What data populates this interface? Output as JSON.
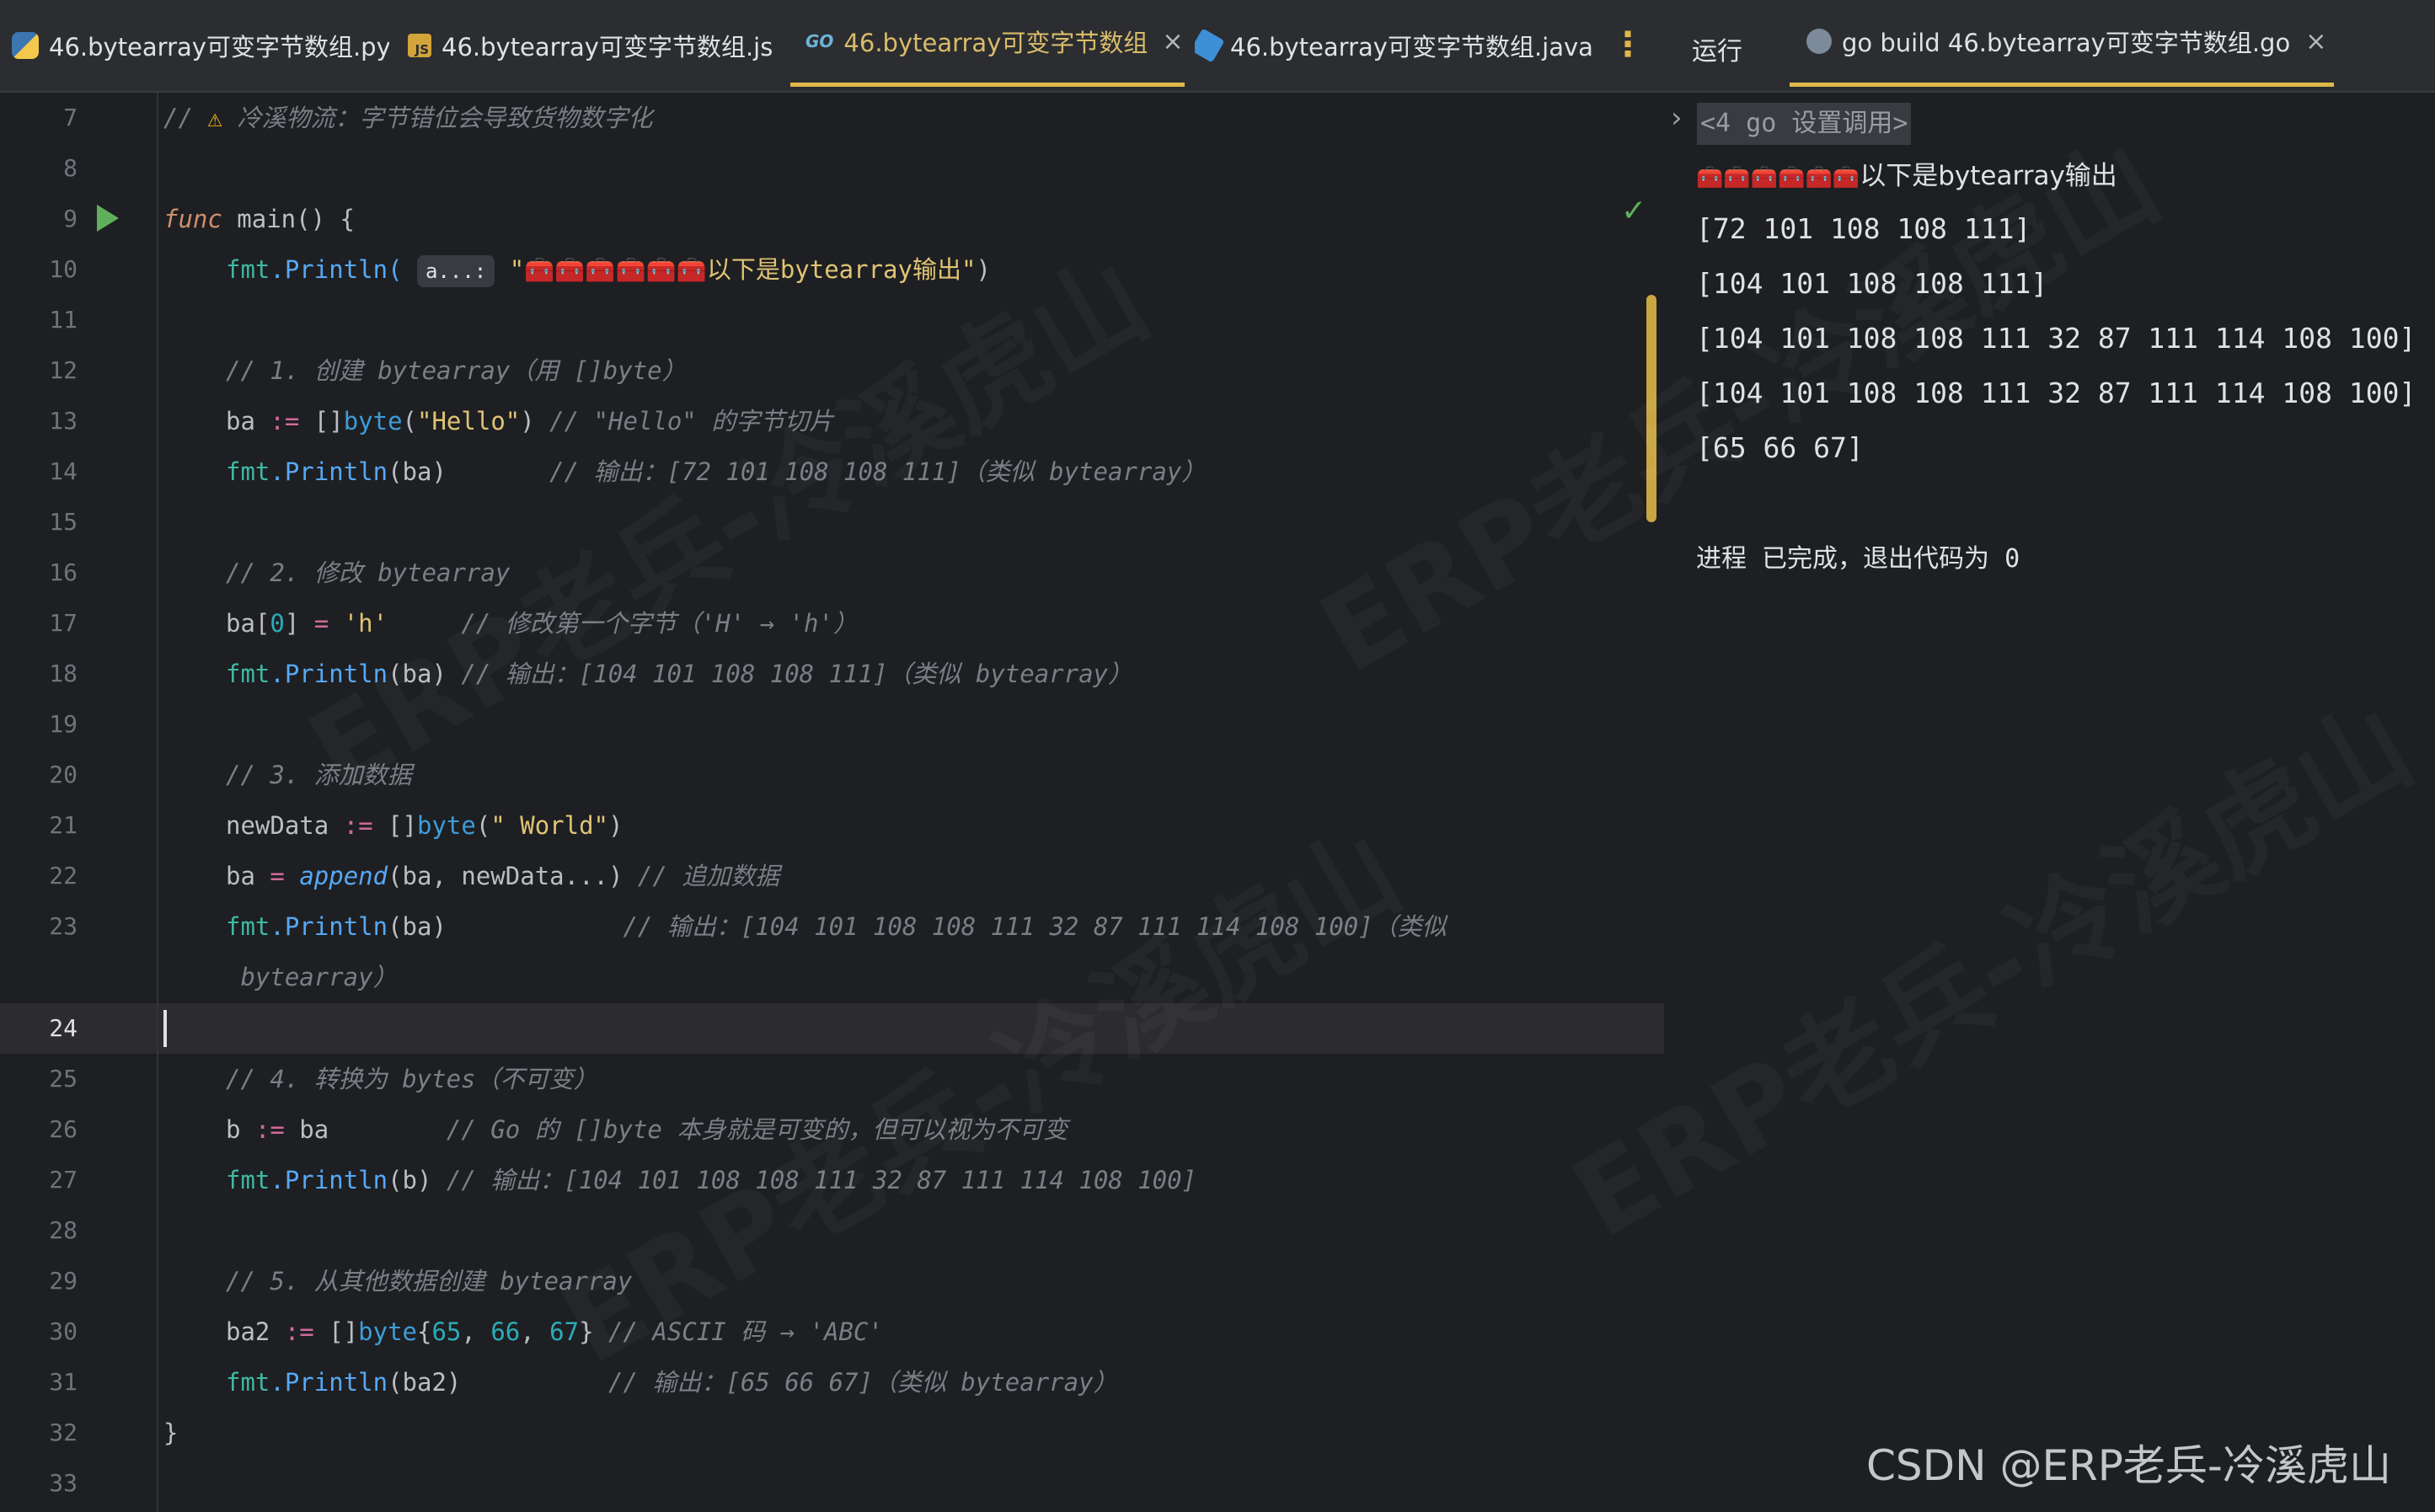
{
  "tabs": [
    {
      "label": "46.bytearray可变字节数组.py",
      "icon": "python-file-icon"
    },
    {
      "label": "46.bytearray可变字节数组.js",
      "icon": "javascript-file-icon"
    },
    {
      "label": "46.bytearray可变字节数组.go",
      "icon": "go-file-icon",
      "active": true
    },
    {
      "label": "46.bytearray可变字节数组.java",
      "icon": "java-file-icon"
    }
  ],
  "go_icon_text": "GO",
  "js_icon_text": "JS",
  "close_glyph": "×",
  "more_glyph": "⋮",
  "run_panel": {
    "title": "运行",
    "config_tab": "go build 46.bytearray可变字节数组.go",
    "command": "<4 go 设置调用>",
    "output_header": "以下是bytearray输出",
    "output_lines": [
      "[72 101 108 108 111]",
      "[104 101 108 108 111]",
      "[104 101 108 108 111 32 87 111 114 108 100]",
      "[104 101 108 108 111 32 87 111 114 108 100]",
      "[65 66 67]"
    ],
    "process_done": "进程 已完成，退出代码为 0"
  },
  "editor": {
    "line_numbers": [
      "7",
      "8",
      "9",
      "10",
      "11",
      "12",
      "13",
      "14",
      "15",
      "16",
      "17",
      "18",
      "19",
      "20",
      "21",
      "22",
      "23",
      "24",
      "25",
      "26",
      "27",
      "28",
      "29",
      "30",
      "31",
      "32",
      "33"
    ],
    "current_line": "24",
    "hint_label": "a...:",
    "lines": {
      "l7_comment": "// ",
      "l7_warn": "⚠",
      "l7_text": " 冷溪物流：字节错位会导致货物数字化",
      "l9_kw": "func",
      "l9_rest": " main() {",
      "l10_pkg": "fmt",
      "l10_fn": ".Println(",
      "l10_str_open": "\"",
      "l10_toolboxes": "🧰🧰🧰🧰🧰🧰",
      "l10_str": "以下是bytearray输出\"",
      "l10_close": ")",
      "l12": "// 1. 创建 bytearray（用 []byte）",
      "l13_a": "ba ",
      "l13_op": ":=",
      "l13_b": " []",
      "l13_typ": "byte",
      "l13_c": "(",
      "l13_str": "\"Hello\"",
      "l13_d": ") ",
      "l13_cmt": "// \"Hello\" 的字节切片",
      "l14_pkg": "fmt",
      "l14_fn": ".Println",
      "l14_b": "(ba)       ",
      "l14_cmt": "// 输出：[72 101 108 108 111]（类似 bytearray）",
      "l16": "// 2. 修改 bytearray",
      "l17_a": "ba[",
      "l17_num": "0",
      "l17_b": "] ",
      "l17_op": "=",
      "l17_c": " ",
      "l17_str": "'h'",
      "l17_d": "     ",
      "l17_cmt": "// 修改第一个字节（'H' → 'h'）",
      "l18_pkg": "fmt",
      "l18_fn": ".Println",
      "l18_b": "(ba) ",
      "l18_cmt": "// 输出：[104 101 108 108 111]（类似 bytearray）",
      "l20": "// 3. 添加数据",
      "l21_a": "newData ",
      "l21_op": ":=",
      "l21_b": " []",
      "l21_typ": "byte",
      "l21_c": "(",
      "l21_str": "\" World\"",
      "l21_d": ")",
      "l22_a": "ba ",
      "l22_op": "=",
      "l22_b": " ",
      "l22_kw": "append",
      "l22_c": "(ba, newData...) ",
      "l22_cmt": "// 追加数据",
      "l23_pkg": "fmt",
      "l23_fn": ".Println",
      "l23_b": "(ba)            ",
      "l23_cmt": "// 输出：[104 101 108 108 111 32 87 111 114 108 100]（类似",
      "l23_wrap": " bytearray）",
      "l25": "// 4. 转换为 bytes（不可变）",
      "l26_a": "b ",
      "l26_op": ":=",
      "l26_b": " ba        ",
      "l26_cmt": "// Go 的 []byte 本身就是可变的，但可以视为不可变",
      "l27_pkg": "fmt",
      "l27_fn": ".Println",
      "l27_b": "(b) ",
      "l27_cmt": "// 输出：[104 101 108 108 111 32 87 111 114 108 100]",
      "l29": "// 5. 从其他数据创建 bytearray",
      "l30_a": "ba2 ",
      "l30_op": ":=",
      "l30_b": " []",
      "l30_typ": "byte",
      "l30_c": "{",
      "l30_n1": "65",
      "l30_d": ", ",
      "l30_n2": "66",
      "l30_e": ", ",
      "l30_n3": "67",
      "l30_f": "} ",
      "l30_cmt": "// ASCII 码 → 'ABC'",
      "l31_pkg": "fmt",
      "l31_fn": ".Println",
      "l31_b": "(ba2)          ",
      "l31_cmt": "// 输出：[65 66 67]（类似 bytearray）",
      "l32": "}"
    }
  },
  "watermark": "ERP老兵-冷溪虎山",
  "footer_mark": "CSDN @ERP老兵-冷溪虎山",
  "colors": {
    "background": "#1e1f22",
    "tab_active_underline": "#e0b84a",
    "comment": "#7a7e85",
    "keyword": "#cf8e6d",
    "function": "#56a8f5",
    "string": "#e0c474",
    "number": "#2aacb8",
    "run_gutter_icon": "#5fb05b"
  }
}
